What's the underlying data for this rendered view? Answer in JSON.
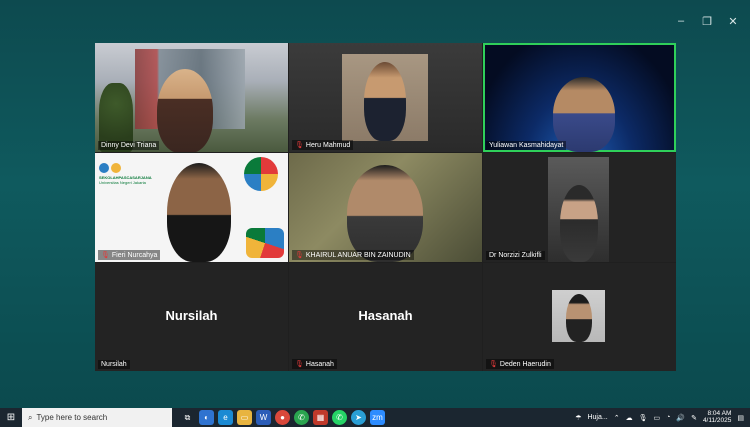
{
  "window": {
    "controls": [
      "–",
      "❐",
      "✕"
    ]
  },
  "participants": [
    {
      "name": "Dinny Devi Triana",
      "muted": false
    },
    {
      "name": "Heru Mahmud",
      "muted": true
    },
    {
      "name": "Yuliawan Kasmahidayat",
      "muted": false,
      "active_speaker": true
    },
    {
      "name": "Fieri Nurcahya",
      "muted": true
    },
    {
      "name": "KHAIRUL ANUAR BIN ZAINUDIN",
      "muted": true
    },
    {
      "name": "Dr Norzizi Zulkifli",
      "muted": false
    },
    {
      "name": "Nursilah",
      "muted": false,
      "video_off": true,
      "display": "Nursilah"
    },
    {
      "name": "Hasanah",
      "muted": true,
      "video_off": true,
      "display": "Hasanah"
    },
    {
      "name": "Deden Haerudin",
      "muted": true
    }
  ],
  "logo_text": {
    "line1": "SEKOLAHPASCASARJANA",
    "line2": "Universitas Negeri Jakarta"
  },
  "taskbar": {
    "search_placeholder": "Type here to search",
    "weather": "Huja...",
    "time": "8:04 AM",
    "date": "4/11/2025",
    "app_icons": [
      "task-view",
      "edge-like",
      "edge",
      "explorer",
      "word",
      "chrome",
      "whatsapp-like",
      "app-red",
      "whatsapp",
      "telegram",
      "zoom"
    ]
  },
  "colors": {
    "active_border": "#2fd05a",
    "muted_icon": "#e23a3a",
    "window_bg": "#0f5a5e",
    "taskbar_bg": "#1b2630"
  }
}
